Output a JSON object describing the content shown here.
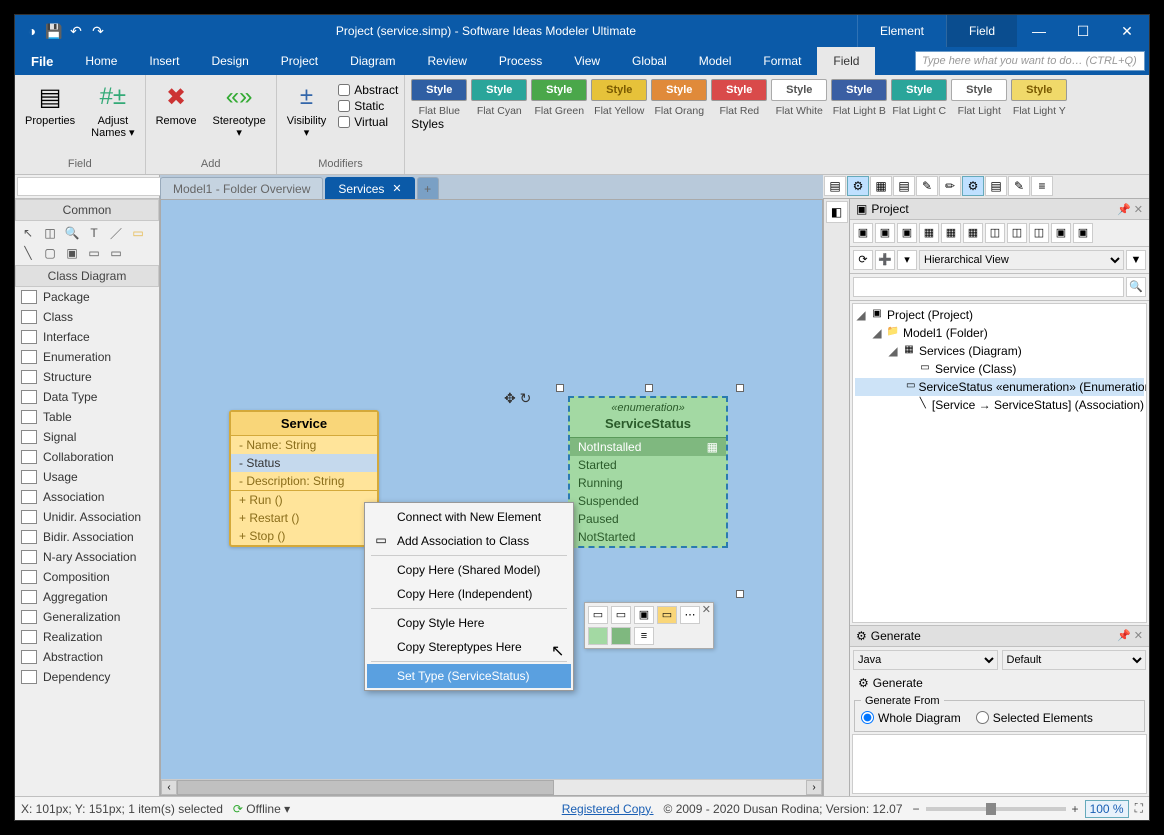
{
  "title": "Project (service.simp)  - Software Ideas Modeler Ultimate",
  "titletabs": {
    "element": "Element",
    "field": "Field"
  },
  "menus": {
    "file": "File",
    "home": "Home",
    "insert": "Insert",
    "design": "Design",
    "project": "Project",
    "diagram": "Diagram",
    "review": "Review",
    "process": "Process",
    "view": "View",
    "global": "Global",
    "model": "Model",
    "format": "Format",
    "field": "Field"
  },
  "searchPlaceholder": "Type here what you want to do…  (CTRL+Q)",
  "ribbon": {
    "properties": "Properties",
    "adjust": "Adjust\nNames ▾",
    "fieldGroup": "Field",
    "remove": "Remove",
    "stereotype": "Stereotype\n▾",
    "addGroup": "Add",
    "visibility": "Visibility\n▾",
    "abstract": "Abstract",
    "static": "Static",
    "virtual": "Virtual",
    "modGroup": "Modifiers",
    "styleLbl": "Style",
    "styleNames": [
      "Flat Blue",
      "Flat Cyan",
      "Flat Green",
      "Flat Yellow",
      "Flat Orang",
      "Flat Red",
      "Flat White",
      "Flat Light B",
      "Flat Light C",
      "Flat Light",
      "Flat Light Y"
    ],
    "styleColors": [
      "#2f5fa3",
      "#2aa59a",
      "#4aa74a",
      "#e6c23a",
      "#e08a3a",
      "#d94a4a",
      "#ffffff",
      "#3a5fa3",
      "#2aa59a",
      "#ffffff",
      "#f0d96a"
    ],
    "styleText": [
      "#fff",
      "#fff",
      "#fff",
      "#7a5a00",
      "#fff",
      "#fff",
      "#555",
      "#fff",
      "#fff",
      "#555",
      "#7a5a00"
    ],
    "stylesGroup": "Styles"
  },
  "leftpanel": {
    "common": "Common",
    "classdiag": "Class Diagram",
    "items": [
      "Package",
      "Class",
      "Interface",
      "Enumeration",
      "Structure",
      "Data Type",
      "Table",
      "Signal",
      "Collaboration",
      "Usage",
      "Association",
      "Unidir. Association",
      "Bidir. Association",
      "N-ary Association",
      "Composition",
      "Aggregation",
      "Generalization",
      "Realization",
      "Abstraction",
      "Dependency"
    ]
  },
  "doctabs": {
    "t1": "Model1 - Folder Overview",
    "t2": "Services"
  },
  "service": {
    "title": "Service",
    "fields": [
      "- Name: String",
      "- Status",
      "- Description: String"
    ],
    "ops": [
      "+ Run ()",
      "+ Restart ()",
      "+ Stop ()"
    ]
  },
  "enum": {
    "stereo": "«enumeration»",
    "title": "ServiceStatus",
    "items": [
      "NotInstalled",
      "Started",
      "Running",
      "Suspended",
      "Paused",
      "NotStarted"
    ]
  },
  "context": {
    "c1": "Connect with New Element",
    "c2": "Add Association to Class",
    "c3": "Copy Here (Shared Model)",
    "c4": "Copy Here (Independent)",
    "c5": "Copy Style Here",
    "c6": "Copy Stereptypes Here",
    "c7": "Set Type (ServiceStatus)"
  },
  "project": {
    "hdr": "Project",
    "view": "Hierarchical View",
    "nodes": {
      "root": "Project (Project)",
      "model": "Model1 (Folder)",
      "diag": "Services (Diagram)",
      "cls": "Service (Class)",
      "enum": "ServiceStatus «enumeration» (Enumeration)",
      "assoc": "[Service → ServiceStatus] (Association)"
    }
  },
  "generate": {
    "hdr": "Generate",
    "lang": "Java",
    "tpl": "Default",
    "btn": "Generate",
    "from": "Generate From",
    "whole": "Whole Diagram",
    "sel": "Selected Elements"
  },
  "status": {
    "pos": "X: 101px; Y: 151px; 1 item(s) selected",
    "offline": "Offline",
    "reg": "Registered Copy.",
    "copy": "© 2009 - 2020 Dusan Rodina; Version: 12.07",
    "zoom": "100 %"
  }
}
